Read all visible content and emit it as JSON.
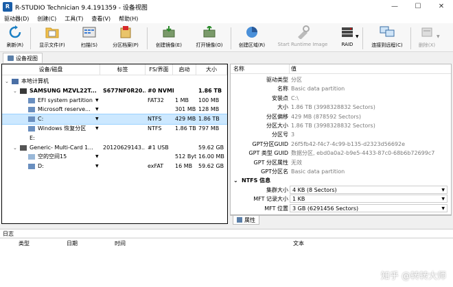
{
  "window": {
    "title": "R-STUDIO Technician 9.4.191359 - 设备视图",
    "minimize": "—",
    "maximize": "☐",
    "close": "✕"
  },
  "menu": [
    "驱动器(D)",
    "创建(C)",
    "工具(T)",
    "查看(V)",
    "帮助(H)"
  ],
  "toolbar": {
    "buttons": [
      {
        "label": "刷新(R)",
        "icon": "refresh-icon",
        "enabled": true
      },
      {
        "label": "显示文件(F)",
        "icon": "folder-icon",
        "enabled": true
      },
      {
        "label": "扫描(S)",
        "icon": "scan-icon",
        "enabled": true
      },
      {
        "label": "分区档案(P)",
        "icon": "partition-archive-icon",
        "enabled": true
      },
      {
        "label": "创建镜像(E)",
        "icon": "create-image-icon",
        "enabled": true
      },
      {
        "label": "打开镜像(O)",
        "icon": "open-image-icon",
        "enabled": true
      },
      {
        "label": "创建区域(R)",
        "icon": "create-region-icon",
        "enabled": true
      },
      {
        "label": "Start Runtime Image",
        "icon": "runtime-image-icon",
        "enabled": false
      },
      {
        "label": "RAID",
        "icon": "raid-icon",
        "enabled": true
      },
      {
        "label": "连接到远程(C)",
        "icon": "remote-connect-icon",
        "enabled": true
      },
      {
        "label": "删除(X)",
        "icon": "delete-icon",
        "enabled": false
      }
    ]
  },
  "tab": {
    "label": "设备视图"
  },
  "tree": {
    "headers": [
      "设备/磁盘",
      "标签",
      "FS/界面",
      "启动",
      "大小"
    ],
    "rows": [
      {
        "name": "本地计算机",
        "label": "",
        "fs": "",
        "start": "",
        "size": "",
        "level": 0,
        "icon": "computer-icon",
        "expander": "⌄",
        "bold": false
      },
      {
        "name": "SAMSUNG MZVL22T...",
        "label": "S677NF0R20...",
        "fs": "#0 NVME, SSD",
        "start": "",
        "size": "1.86 TB",
        "level": 1,
        "icon": "hdd-icon",
        "expander": "⌄",
        "bold": true
      },
      {
        "name": "EFI system partition",
        "label": "",
        "fs": "FAT32",
        "start": "1 MB",
        "size": "100 MB",
        "level": 2,
        "icon": "partition-icon",
        "expander": "",
        "bold": false
      },
      {
        "name": "Microsoft reserve...",
        "label": "",
        "fs": "",
        "start": "301 MB",
        "size": "128 MB",
        "level": 2,
        "icon": "partition-icon",
        "expander": "",
        "bold": false
      },
      {
        "name": "C:",
        "label": "",
        "fs": "NTFS",
        "start": "429 MB",
        "size": "1.86 TB",
        "level": 2,
        "icon": "partition-icon",
        "expander": "",
        "bold": false,
        "selected": true
      },
      {
        "name": "Windows 恢复分区",
        "label": "",
        "fs": "NTFS",
        "start": "1.86 TB",
        "size": "797 MB",
        "level": 2,
        "icon": "partition-icon",
        "expander": "",
        "bold": false
      },
      {
        "name": "E:",
        "label": "",
        "fs": "",
        "start": "",
        "size": "",
        "level": 1,
        "icon": "",
        "expander": "",
        "bold": false
      },
      {
        "name": "Generic- Multi-Card 1...",
        "label": "20120629143...",
        "fs": "#1 USB",
        "start": "",
        "size": "59.62 GB",
        "level": 1,
        "icon": "usb-icon",
        "expander": "⌄",
        "bold": false
      },
      {
        "name": "空的空间15",
        "label": "",
        "fs": "",
        "start": "512 Byt...",
        "size": "16.00 MB",
        "level": 2,
        "icon": "empty-space-icon",
        "expander": "",
        "bold": false
      },
      {
        "name": "D:",
        "label": "",
        "fs": "exFAT",
        "start": "16 MB",
        "size": "59.62 GB",
        "level": 2,
        "icon": "partition-icon",
        "expander": "",
        "bold": false
      }
    ]
  },
  "properties": {
    "headers": [
      "名称",
      "值"
    ],
    "rows": [
      {
        "name": "驱动类型",
        "value": "分区",
        "gray": true
      },
      {
        "name": "名称",
        "value": "Basic data partition",
        "gray": true
      },
      {
        "name": "安装点",
        "value": "C:\\",
        "gray": true
      },
      {
        "name": "大小",
        "value": "1.86 TB (3998328832 Sectors)",
        "gray": true
      },
      {
        "name": "分区偏移",
        "value": "429 MB (878592 Sectors)",
        "gray": true
      },
      {
        "name": "分区大小",
        "value": "1.86 TB (3998328832 Sectors)",
        "gray": true
      },
      {
        "name": "分区号",
        "value": "3",
        "gray": true
      },
      {
        "name": "GPT分区GUID",
        "value": "26f5fb42-f4c7-4c99-b135-d2323d56692e",
        "gray": true
      },
      {
        "name": "GPT 类型 GUID",
        "value": "数据分区, ebd0a0a2-b9e5-4433-87c0-68b6b72699c7",
        "gray": true
      },
      {
        "name": "GPT 分区属性",
        "value": "无效",
        "gray": true
      },
      {
        "name": "GPT分区名",
        "value": "Basic data partition",
        "gray": true
      }
    ],
    "section": "NTFS 信息",
    "ntfs_rows": [
      {
        "name": "集群大小",
        "value": "4 KB (8 Sectors)"
      },
      {
        "name": "MFT 记录大小",
        "value": "1 KB"
      },
      {
        "name": "MFT 位置",
        "value": "3 GB (6291456 Sectors)"
      }
    ],
    "tab_label": "属性"
  },
  "log": {
    "title": "日志",
    "headers": [
      "类型",
      "日期",
      "时间",
      "文本"
    ]
  },
  "watermark": "知乎 @转转大师",
  "colors": {
    "selection": "#cce8ff",
    "accent": "#1a5ea8"
  }
}
